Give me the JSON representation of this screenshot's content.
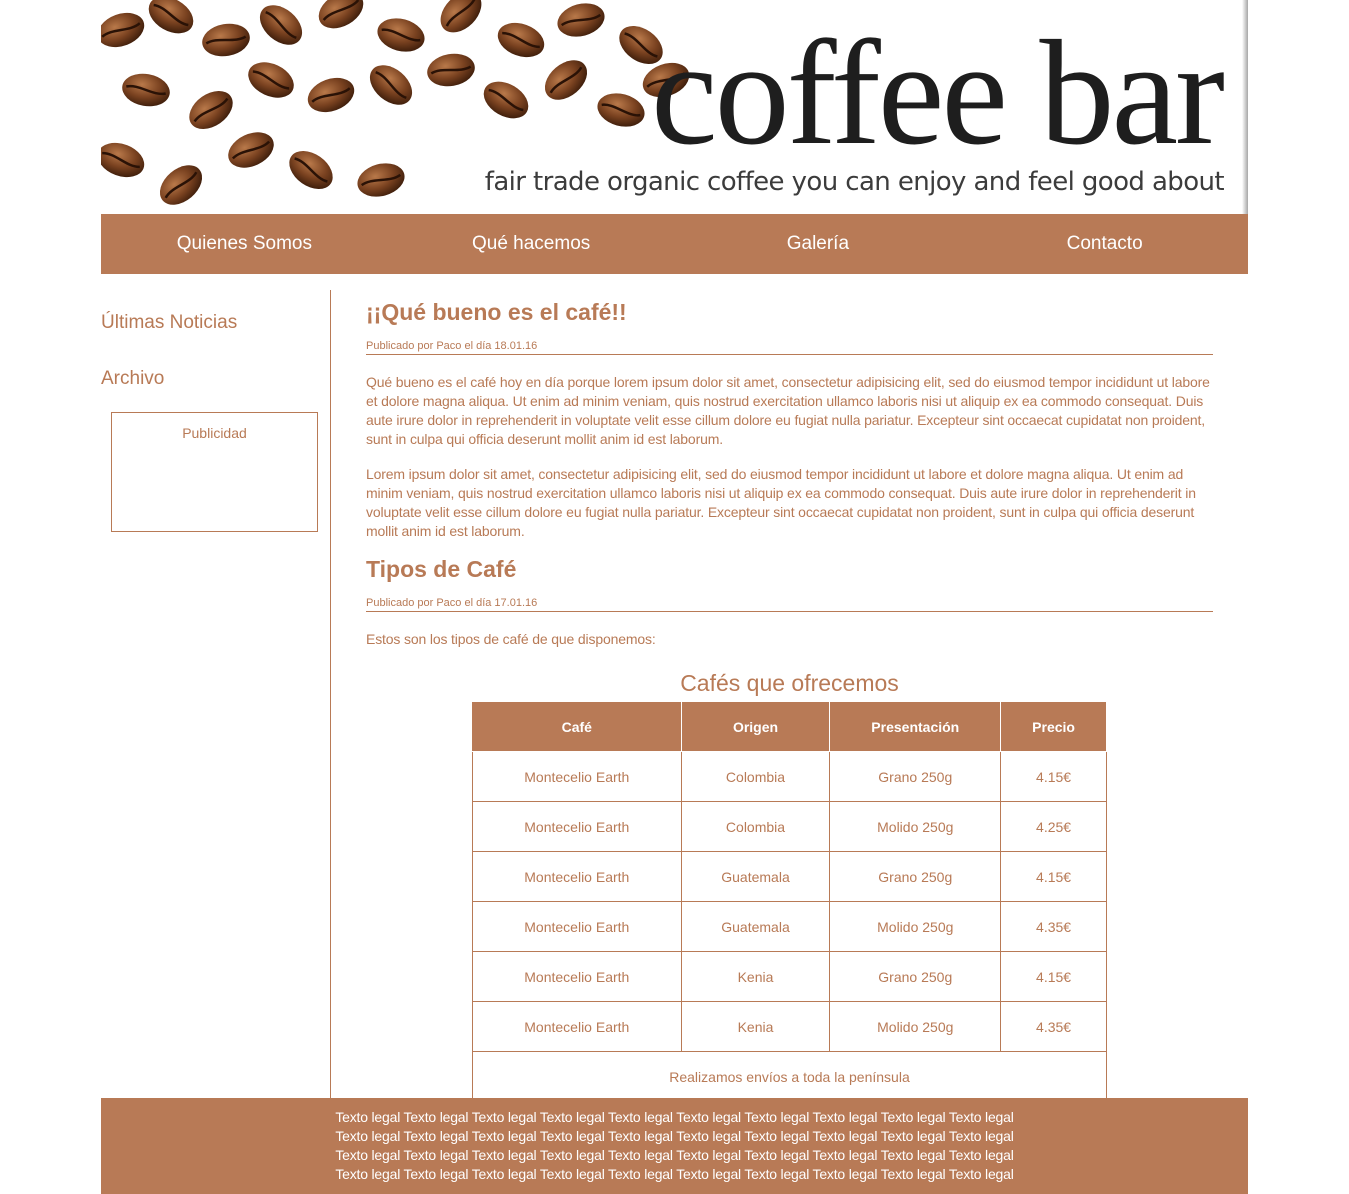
{
  "header": {
    "brand_title": "coffee bar",
    "tagline": "fair trade organic coffee you can enjoy and feel good about"
  },
  "nav": {
    "items": [
      "Quienes Somos",
      "Qué hacemos",
      "Galería",
      "Contacto"
    ]
  },
  "sidebar": {
    "news": "Últimas Noticias",
    "archive": "Archivo",
    "ad_label": "Publicidad"
  },
  "posts": [
    {
      "title": "¡¡Qué bueno es el café!!",
      "meta": "Publicado por Paco el día 18.01.16",
      "paragraphs": [
        "Qué bueno es el café hoy en día porque lorem ipsum dolor sit amet, consectetur adipisicing elit, sed do eiusmod tempor incididunt ut labore et dolore magna aliqua. Ut enim ad minim veniam, quis nostrud exercitation ullamco laboris nisi ut aliquip ex ea commodo consequat. Duis aute irure dolor in reprehenderit in voluptate velit esse cillum dolore eu fugiat nulla pariatur. Excepteur sint occaecat cupidatat non proident, sunt in culpa qui officia deserunt mollit anim id est laborum.",
        "Lorem ipsum dolor sit amet, consectetur adipisicing elit, sed do eiusmod tempor incididunt ut labore et dolore magna aliqua. Ut enim ad minim veniam, quis nostrud exercitation ullamco laboris nisi ut aliquip ex ea commodo consequat. Duis aute irure dolor in reprehenderit in voluptate velit esse cillum dolore eu fugiat nulla pariatur. Excepteur sint occaecat cupidatat non proident, sunt in culpa qui officia deserunt mollit anim id est laborum."
      ]
    },
    {
      "title": "Tipos de Café",
      "meta": "Publicado por Paco el día 17.01.16",
      "paragraphs": [
        "Estos son los tipos de café de que disponemos:"
      ]
    }
  ],
  "table": {
    "caption": "Cafés que ofrecemos",
    "headers": [
      "Café",
      "Origen",
      "Presentación",
      "Precio"
    ],
    "rows": [
      [
        "Montecelio Earth",
        "Colombia",
        "Grano 250g",
        "4.15€"
      ],
      [
        "Montecelio Earth",
        "Colombia",
        "Molido 250g",
        "4.25€"
      ],
      [
        "Montecelio Earth",
        "Guatemala",
        "Grano 250g",
        "4.15€"
      ],
      [
        "Montecelio Earth",
        "Guatemala",
        "Molido 250g",
        "4.35€"
      ],
      [
        "Montecelio Earth",
        "Kenia",
        "Grano 250g",
        "4.15€"
      ],
      [
        "Montecelio Earth",
        "Kenia",
        "Molido 250g",
        "4.35€"
      ]
    ],
    "footer_note": "Realizamos envíos a toda la península"
  },
  "footer": {
    "legal_lines": [
      "Texto legal Texto legal Texto legal Texto legal Texto legal Texto legal Texto legal Texto legal Texto legal Texto legal",
      "Texto legal Texto legal Texto legal Texto legal Texto legal Texto legal Texto legal Texto legal Texto legal Texto legal",
      "Texto legal Texto legal Texto legal Texto legal Texto legal Texto legal Texto legal Texto legal Texto legal Texto legal",
      "Texto legal Texto legal Texto legal Texto legal Texto legal Texto legal Texto legal Texto legal Texto legal Texto legal"
    ]
  },
  "colors": {
    "accent": "#b87a56",
    "text_on_accent": "#ffffff",
    "brand_text": "#1e1e1e"
  }
}
